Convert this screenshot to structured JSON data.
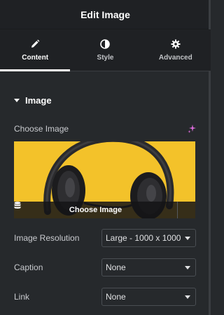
{
  "header": {
    "title": "Edit Image"
  },
  "tabs": [
    {
      "label": "Content",
      "icon": "pencil-icon",
      "active": true
    },
    {
      "label": "Style",
      "icon": "half-circle-icon",
      "active": false
    },
    {
      "label": "Advanced",
      "icon": "gear-icon",
      "active": false
    }
  ],
  "section": {
    "title": "Image"
  },
  "image_control": {
    "label": "Choose Image",
    "button_label": "Choose Image",
    "ai_icon": "sparkle-icon",
    "library_icon": "database-icon"
  },
  "fields": {
    "resolution": {
      "label": "Image Resolution",
      "value": "Large - 1000 x 1000"
    },
    "caption": {
      "label": "Caption",
      "value": "None"
    },
    "link": {
      "label": "Link",
      "value": "None"
    }
  },
  "colors": {
    "panel_bg": "#26292c",
    "header_bg": "#1f2124",
    "image_bg": "#f3c22a",
    "ai_accent": "#d86ad8"
  }
}
